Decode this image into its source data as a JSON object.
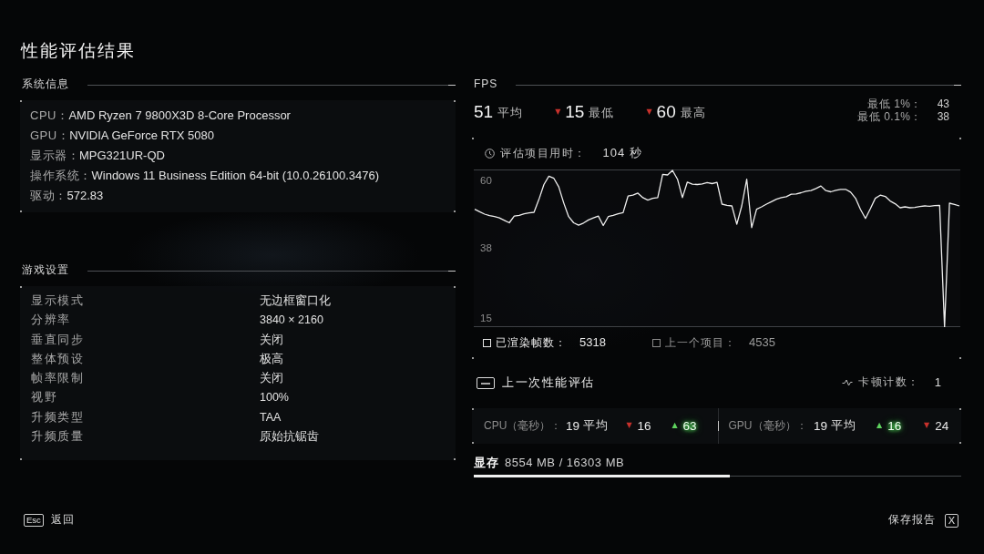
{
  "title": "性能评估结果",
  "system_info": {
    "heading": "系统信息",
    "rows": [
      {
        "label": "CPU：",
        "value": "AMD Ryzen 7 9800X3D 8-Core Processor"
      },
      {
        "label": "GPU：",
        "value": "NVIDIA GeForce RTX 5080"
      },
      {
        "label": "显示器：",
        "value": "MPG321UR-QD"
      },
      {
        "label": "操作系统：",
        "value": "Windows 11 Business Edition 64-bit (10.0.26100.3476)"
      },
      {
        "label": "驱动：",
        "value": "572.83"
      }
    ]
  },
  "game_settings": {
    "heading": "游戏设置",
    "rows": [
      {
        "label": "显示模式",
        "value": "无边框窗口化"
      },
      {
        "label": "分辨率",
        "value": "3840 × 2160"
      },
      {
        "label": "垂直同步",
        "value": "关闭"
      },
      {
        "label": "整体预设",
        "value": "极高"
      },
      {
        "label": "帧率限制",
        "value": "关闭"
      },
      {
        "label": "视野",
        "value": "100%"
      },
      {
        "label": "升频类型",
        "value": "TAA"
      },
      {
        "label": "升频质量",
        "value": "原始抗锯齿"
      }
    ]
  },
  "fps": {
    "heading": "FPS",
    "stats": [
      {
        "value": "51",
        "label": "平均"
      },
      {
        "arrow": "▼",
        "color": "#c8312c",
        "value": "15",
        "label": "最低"
      },
      {
        "arrow": "▼",
        "color": "#c8312c",
        "value": "60",
        "label": "最高"
      }
    ],
    "percentiles": [
      {
        "label": "最低 1%：",
        "value": "43"
      },
      {
        "label": "最低 0.1%：",
        "value": "38"
      }
    ],
    "duration": {
      "label": "评估项目用时：",
      "value": "104 秒"
    },
    "chart_data": {
      "type": "line",
      "tick_labels": "y",
      "ylim": [
        12,
        63.5
      ],
      "yticks": [
        15,
        38,
        60
      ],
      "categories": [
        null,
        null,
        null,
        null,
        null,
        null,
        null,
        null,
        null,
        null,
        null,
        null,
        null,
        null,
        null,
        null,
        null,
        null,
        null,
        null,
        null,
        null,
        null,
        null,
        null,
        null,
        null,
        null,
        null,
        null,
        null,
        null,
        null,
        null,
        null,
        null,
        null,
        null,
        null,
        null,
        null,
        null,
        null,
        null,
        null,
        null,
        null,
        null,
        null,
        null,
        null,
        null,
        null,
        null,
        null,
        null,
        null,
        null,
        null,
        null,
        null,
        null,
        null,
        null,
        null,
        null,
        null,
        null,
        null,
        null,
        null,
        null,
        null,
        null,
        null,
        null,
        null,
        null,
        null,
        null,
        null,
        null,
        null,
        null,
        null,
        null,
        null,
        null,
        null,
        null,
        null,
        null,
        null,
        null,
        null,
        null,
        null,
        null,
        null
      ],
      "values": [
        50.5,
        49.7,
        48.9,
        48.4,
        48.1,
        47.7,
        46.9,
        46.1,
        48.3,
        48.5,
        49.0,
        49.3,
        49.5,
        53.8,
        58.6,
        61.3,
        60.6,
        57.8,
        52.6,
        48.1,
        46.1,
        45.3,
        46.0,
        47.0,
        47.7,
        48.3,
        45.2,
        48.1,
        48.5,
        49.0,
        49.4,
        54.8,
        55.1,
        55.8,
        54.3,
        53.5,
        54.1,
        54.3,
        61.9,
        61.7,
        63.2,
        60.3,
        54.3,
        59.4,
        58.7,
        58.6,
        58.8,
        59.2,
        58.9,
        59.3,
        52.2,
        51.8,
        51.6,
        45.6,
        51.6,
        60.3,
        44.5,
        50.5,
        51.3,
        52.2,
        53.0,
        53.8,
        54.3,
        54.6,
        55.4,
        55.5,
        55.9,
        56.4,
        56.6,
        57.3,
        58.1,
        56.6,
        56.2,
        56.7,
        57.0,
        57.0,
        56.1,
        54.1,
        50.5,
        47.5,
        50.7,
        54.1,
        55.1,
        54.7,
        53.2,
        52.3,
        51.0,
        51.3,
        51.0,
        51.1,
        51.4,
        51.6,
        51.5,
        51.7,
        51.8,
        12.0,
        52.5,
        52.1,
        51.6
      ]
    },
    "counters": [
      {
        "kind": "current",
        "label": "已渲染帧数：",
        "value": "5318"
      },
      {
        "kind": "previous",
        "label": "上一个项目：",
        "value": "4535"
      }
    ]
  },
  "previous": {
    "heading": "上一次性能评估",
    "stutter": {
      "label": "卡顿计数：",
      "value": "1"
    },
    "timings": [
      {
        "label": "CPU（毫秒）：",
        "average": "19",
        "average_label": "平均",
        "stats": [
          {
            "arrow": "▼",
            "color": "#c8312c",
            "value": "16",
            "highlighted": false
          },
          {
            "arrow": "▲",
            "color": "#5fd35f",
            "value": "63",
            "highlighted": true
          }
        ]
      },
      {
        "label": "GPU（毫秒）：",
        "average": "19",
        "average_label": "平均",
        "stats": [
          {
            "arrow": "▲",
            "color": "#5fd35f",
            "value": "16",
            "highlighted": true
          },
          {
            "arrow": "▼",
            "color": "#c8312c",
            "value": "24",
            "highlighted": false
          }
        ]
      }
    ]
  },
  "vram": {
    "label": "显存",
    "value": "8554 MB / 16303 MB",
    "level": 0.525
  },
  "footer": {
    "back": {
      "key": "Esc",
      "label": "返回"
    },
    "save": {
      "label": "保存报告",
      "key": "X"
    }
  }
}
